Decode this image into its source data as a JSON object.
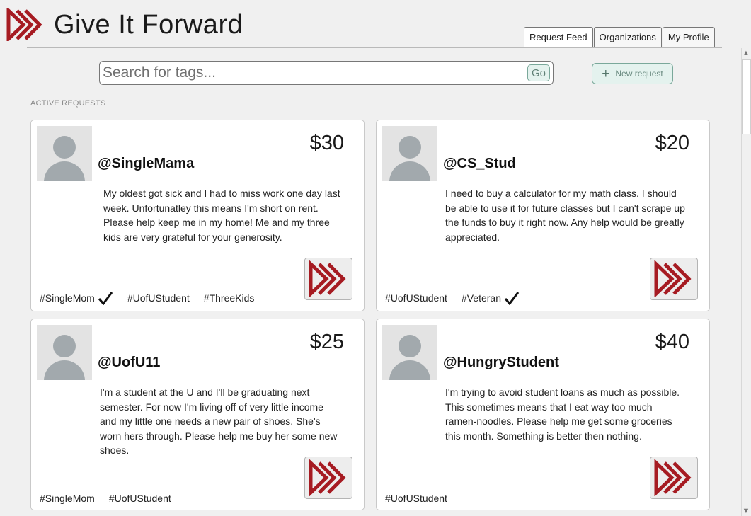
{
  "app": {
    "title": "Give It Forward",
    "brand_color": "#a61b22"
  },
  "tabs": [
    {
      "label": "Request Feed",
      "active": true
    },
    {
      "label": "Organizations",
      "active": false
    },
    {
      "label": "My Profile",
      "active": false
    }
  ],
  "search": {
    "placeholder": "Search for tags...",
    "value": "",
    "go_label": "Go"
  },
  "new_request": {
    "label": "New request",
    "icon": "plus-icon"
  },
  "section_label": "ACTIVE REQUESTS",
  "requests": [
    {
      "username": "@SingleMama",
      "amount": "$30",
      "description": "My oldest got sick and I had to miss work one day last week. Unfortunatley this means I'm short on rent. Please help keep me in my home! Me and my three kids are very grateful for your generosity.",
      "tags": [
        {
          "label": "#SingleMom",
          "verified": true
        },
        {
          "label": "#UofUStudent",
          "verified": false
        },
        {
          "label": "#ThreeKids",
          "verified": false
        }
      ]
    },
    {
      "username": "@CS_Stud",
      "amount": "$20",
      "description": "I need to buy a calculator for my math class. I should be able to use it for future classes but I can't scrape up the funds to buy it right now. Any help would be greatly appreciated.",
      "tags": [
        {
          "label": "#UofUStudent",
          "verified": false
        },
        {
          "label": "#Veteran",
          "verified": true
        }
      ]
    },
    {
      "username": "@UofU11",
      "amount": "$25",
      "description": "I'm a student at the U and I'll be graduating next semester. For now I'm living off of very little income and my little one needs a new pair of shoes. She's worn hers through. Please help me buy her some new shoes.",
      "tags": [
        {
          "label": "#SingleMom",
          "verified": false
        },
        {
          "label": "#UofUStudent",
          "verified": false
        }
      ]
    },
    {
      "username": "@HungryStudent",
      "amount": "$40",
      "description": "I'm trying to avoid student loans as much as possible. This sometimes means that I eat way too much ramen-noodles. Please help me get some groceries this month. Something is better then nothing.",
      "tags": [
        {
          "label": "#UofUStudent",
          "verified": false
        }
      ]
    }
  ]
}
